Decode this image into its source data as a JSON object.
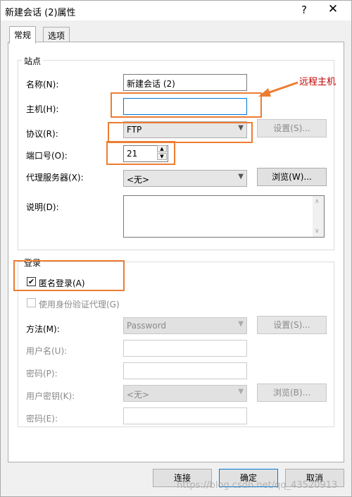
{
  "window": {
    "title": "新建会话 (2)属性",
    "help": "?",
    "close": "✕"
  },
  "tabs": [
    {
      "label": "常规"
    },
    {
      "label": "选项"
    }
  ],
  "site_group": {
    "title": "站点",
    "name_label": "名称(N):",
    "name_value": "新建会话 (2)",
    "host_label": "主机(H):",
    "host_value": "",
    "protocol_label": "协议(R):",
    "protocol_value": "FTP",
    "protocol_settings": "设置(S)...",
    "port_label": "端口号(O):",
    "port_value": "21",
    "proxy_label": "代理服务器(X):",
    "proxy_value": "<无>",
    "proxy_browse": "浏览(W)...",
    "desc_label": "说明(D):"
  },
  "login_group": {
    "title": "登录",
    "anonymous_label": "匿名登录(A)",
    "anonymous_checked": "✔",
    "auth_agent_label": "使用身份验证代理(G)",
    "method_label": "方法(M):",
    "method_value": "Password",
    "method_settings": "设置(S)...",
    "username_label": "用户名(U):",
    "password_label": "密码(P):",
    "userkey_label": "用户密钥(K):",
    "userkey_value": "<无>",
    "userkey_browse": "浏览(B)...",
    "passphrase_label": "密码(E):"
  },
  "footer": {
    "connect": "连接",
    "ok": "确定",
    "cancel": "取消"
  },
  "annotation": {
    "text": "远程主机"
  },
  "watermark": "https://blog.csdn.net/qq_43520913",
  "colors": {
    "highlight": "#ed7d31",
    "annotation_text": "#c00000",
    "focus": "#0078d7"
  }
}
